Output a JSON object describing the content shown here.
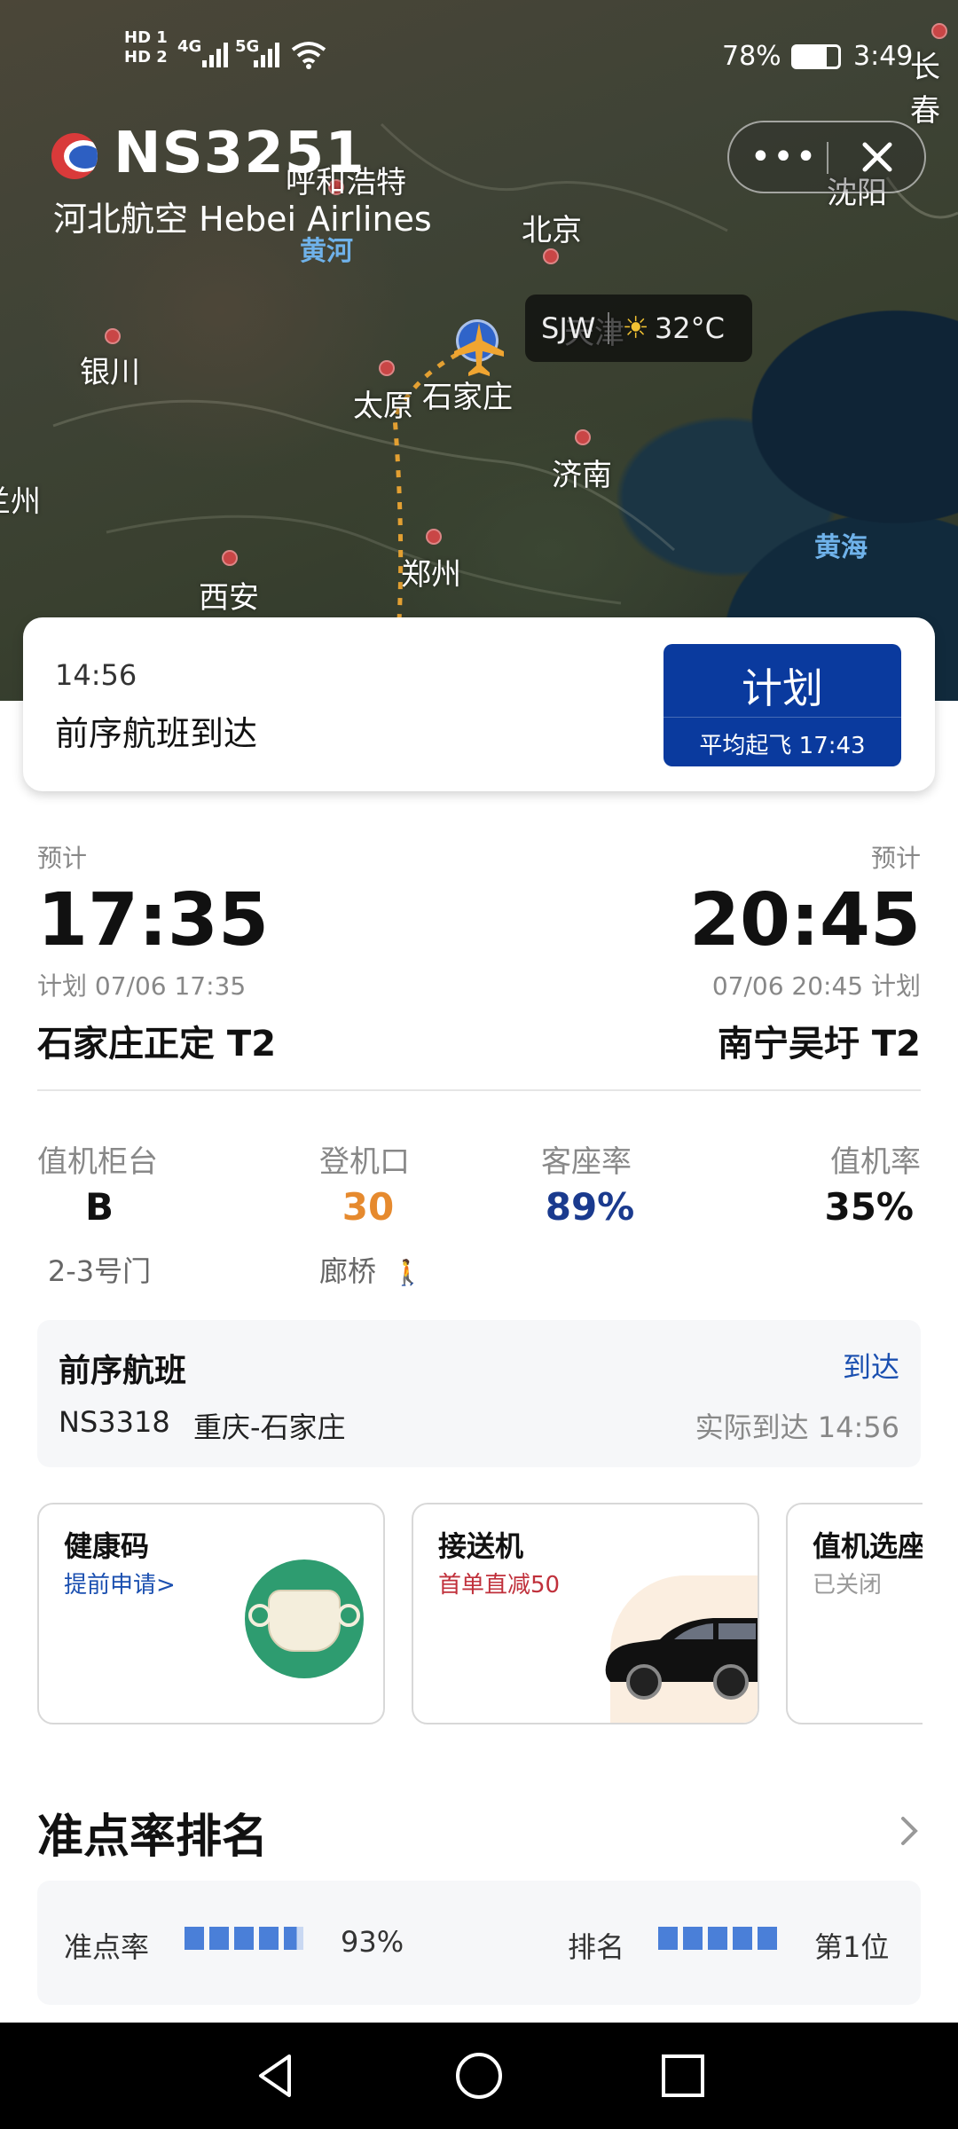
{
  "status_bar": {
    "network_labels": [
      "HD 1",
      "HD 2",
      "4G",
      "5G"
    ],
    "battery": "78%",
    "time": "3:49"
  },
  "header": {
    "flight_number": "NS3251",
    "airline": "河北航空 Hebei Airlines",
    "more_icon": "more-icon",
    "close_icon": "close-icon"
  },
  "map": {
    "cities": [
      "呼和浩特",
      "北京",
      "沈阳",
      "长春",
      "银川",
      "太原",
      "石家庄",
      "天津",
      "济南",
      "兰州",
      "郑州",
      "西安"
    ],
    "waters": [
      "黄河",
      "黄海"
    ],
    "weather_airport": "SJW",
    "weather_temp": "32°C"
  },
  "status_card": {
    "time": "14:56",
    "text": "前序航班到达",
    "status_label": "计划",
    "status_sub": "平均起飞 17:43",
    "status_color": "#0a3a9e"
  },
  "departure": {
    "label": "预计",
    "time": "17:35",
    "planned": "计划 07/06 17:35",
    "airport": "石家庄正定 T2"
  },
  "arrival": {
    "label": "预计",
    "time": "20:45",
    "planned": "07/06 20:45 计划",
    "airport": "南宁吴圩 T2"
  },
  "info": {
    "checkin_label": "值机柜台",
    "checkin_value": "B",
    "checkin_sub": "2-3号门",
    "gate_label": "登机口",
    "gate_value": "30",
    "gate_sub": "廊桥",
    "gate_color": "#e68a2e",
    "load_label": "客座率",
    "load_value": "89%",
    "load_color": "#1a3a8e",
    "checkin_rate_label": "值机率",
    "checkin_rate_value": "35%"
  },
  "previous_flight": {
    "title": "前序航班",
    "status": "到达",
    "flight": "NS3318",
    "route": "重庆-石家庄",
    "actual": "实际到达 14:56"
  },
  "features": [
    {
      "title": "健康码",
      "sub": "提前申请>",
      "icon": "mask-icon"
    },
    {
      "title": "接送机",
      "sub": "首单直减50",
      "icon": "car-icon"
    },
    {
      "title": "值机选座",
      "sub": "已关闭"
    }
  ],
  "ontime": {
    "title": "准点率排名",
    "rate_label": "准点率",
    "rate_value": "93%",
    "rate_fraction": 0.93,
    "rank_label": "排名",
    "rank_value": "第1位"
  },
  "nav": {
    "back_icon": "back-icon",
    "home_icon": "home-icon",
    "recents_icon": "recents-icon"
  }
}
